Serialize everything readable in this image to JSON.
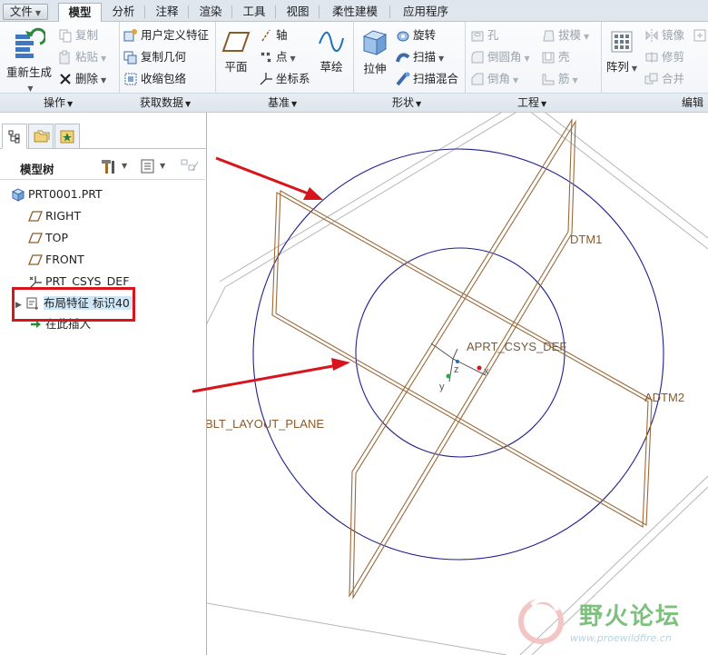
{
  "menu": {
    "tabs": [
      {
        "label": "文件",
        "has_dropdown": true
      },
      {
        "label": "模型",
        "active": true
      },
      {
        "label": "分析"
      },
      {
        "label": "注释"
      },
      {
        "label": "渲染"
      },
      {
        "label": "工具"
      },
      {
        "label": "视图"
      },
      {
        "label": "柔性建模"
      },
      {
        "label": "应用程序"
      }
    ]
  },
  "ribbon": {
    "operations": {
      "label": "操作",
      "regenerate": "重新生成",
      "copy": "复制",
      "paste": "粘贴",
      "delete": "删除"
    },
    "get_data": {
      "label": "获取数据",
      "udf": "用户定义特征",
      "copy_geometry": "复制几何",
      "shrinkwrap": "收缩包络"
    },
    "datum": {
      "label": "基准",
      "plane": "平面",
      "axis": "轴",
      "point": "点",
      "csys": "坐标系",
      "sketch": "草绘"
    },
    "shapes": {
      "label": "形状",
      "extrude": "拉伸",
      "revolve": "旋转",
      "sweep": "扫描",
      "swept_blend": "扫描混合"
    },
    "engineering": {
      "label": "工程",
      "hole": "孔",
      "round": "倒圆角",
      "chamfer": "倒角",
      "draft": "拔模",
      "shell": "壳",
      "rib": "筋"
    },
    "editing": {
      "label": "编辑",
      "pattern": "阵列",
      "mirror": "镜像",
      "trim": "修剪",
      "merge": "合并"
    }
  },
  "model_tree": {
    "title": "模型树",
    "items": [
      {
        "label": "PRT0001.PRT",
        "icon": "part-icon"
      },
      {
        "label": "RIGHT",
        "icon": "datum-plane-icon"
      },
      {
        "label": "TOP",
        "icon": "datum-plane-icon"
      },
      {
        "label": "FRONT",
        "icon": "datum-plane-icon"
      },
      {
        "label": "PRT_CSYS_DEF",
        "icon": "csys-icon"
      },
      {
        "label": "布局特征 标识40",
        "icon": "layout-feature-icon",
        "selected": true
      },
      {
        "label": "在此插入",
        "icon": "insert-here-icon"
      }
    ]
  },
  "graphics": {
    "labels": {
      "dtm1": "DTM1",
      "dtm2": "ADTM2",
      "csys": "APRT_CSYS_DEF",
      "layout_plane": "BLT_LAYOUT_PLANE",
      "axis_x": "x",
      "axis_y": "y",
      "axis_z": "z"
    }
  },
  "watermark": {
    "name": "野火论坛",
    "url": "www.proewildfire.cn"
  },
  "colors": {
    "datum_plane": "#9a6a3a",
    "circle": "#1f1f8f",
    "annotation_arrow": "#d8141c",
    "selection": "#cfe8f9",
    "watermark_green": "#7ec07e"
  }
}
